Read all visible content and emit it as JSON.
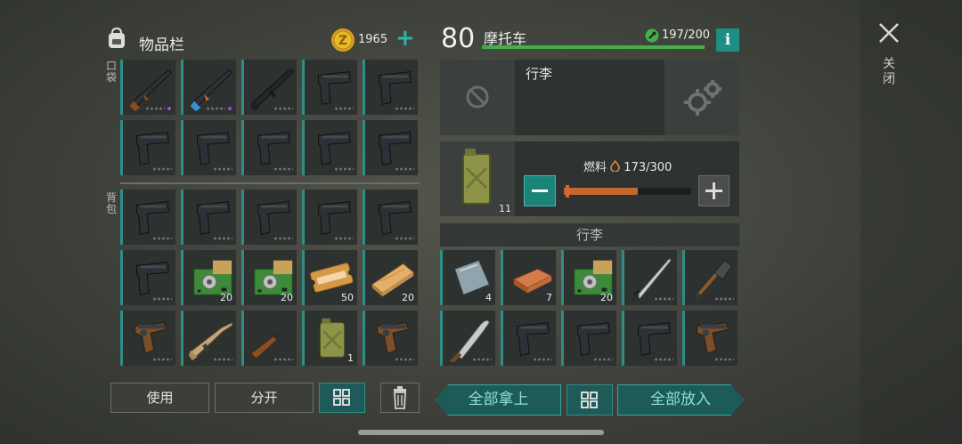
{
  "inventory": {
    "title": "物品栏",
    "coins": "1965",
    "pocket_label": "口袋",
    "backpack_label": "背包",
    "use_label": "使用",
    "split_label": "分开"
  },
  "vehicle": {
    "level": "80",
    "name": "摩托车",
    "durability": "197/200",
    "info_label": "i",
    "trunk_label": "行李",
    "fuel_label": "燃料",
    "fuel_value": "173/300",
    "fuel_fraction": 0.577,
    "fuel_can_count": "11",
    "luggage_title": "行李",
    "take_all_label": "全部拿上",
    "put_all_label": "全部放入"
  },
  "close_label": "关闭",
  "slot_quantities": {
    "b6": "20",
    "b7": "20",
    "b8": "50",
    "b9": "20",
    "b13": "1",
    "l0": "4",
    "l1": "7",
    "l2": "20"
  },
  "icons": {
    "bag": "backpack-icon",
    "coin": "coin-icon",
    "close": "close-icon",
    "gear": "gear-icon",
    "blocked": "blocked-icon"
  },
  "colors": {
    "accent": "#2db5a4",
    "hp": "#3fb04a",
    "fuel": "#c1682e",
    "rare": "#a24fd6"
  }
}
